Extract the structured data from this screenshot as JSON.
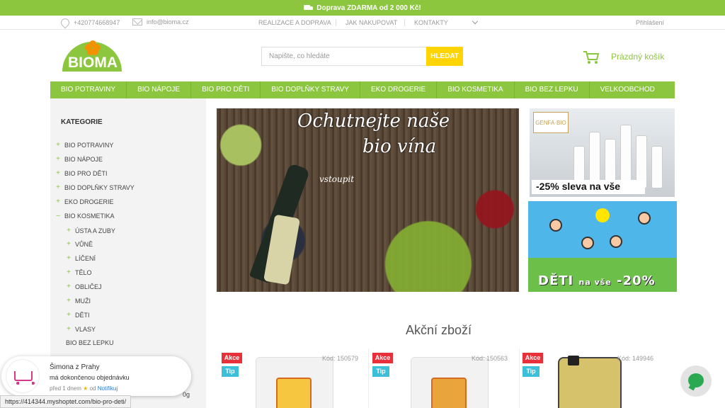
{
  "topbar": {
    "shipping_text": "Doprava ZDARMA od 2 000 Kč!"
  },
  "contact": {
    "phone": "+420774668947",
    "email": "info@bioma.cz"
  },
  "utility_nav": [
    "REALIZACE A DOPRAVA",
    "JAK NAKUPOVAT",
    "KONTAKTY"
  ],
  "login": "Přihlášení",
  "logo": {
    "text": "BIOMA"
  },
  "search": {
    "placeholder": "Napište, co hledáte",
    "button": "HLEDAT"
  },
  "cart": {
    "label": "Prázdný košík"
  },
  "main_nav": [
    "BIO POTRAVINY",
    "BIO NÁPOJE",
    "BIO PRO DĚTI",
    "BIO DOPLŇKY STRAVY",
    "EKO DROGERIE",
    "BIO KOSMETIKA",
    "BIO BEZ LEPKU",
    "VELKOOBCHOD"
  ],
  "sidebar": {
    "title": "KATEGORIE",
    "categories": [
      {
        "label": "BIO POTRAVINY",
        "sym": "+"
      },
      {
        "label": "BIO NÁPOJE",
        "sym": "+"
      },
      {
        "label": "BIO PRO DĚTI",
        "sym": "+"
      },
      {
        "label": "BIO DOPLŇKY STRAVY",
        "sym": "+"
      },
      {
        "label": "EKO DROGERIE",
        "sym": "+"
      },
      {
        "label": "BIO KOSMETIKA",
        "sym": "–"
      }
    ],
    "subcategories": [
      "ÚSTA A ZUBY",
      "VŮNĚ",
      "LÍČENÍ",
      "TĚLO",
      "OBLIČEJ",
      "MUŽI",
      "DĚTI",
      "VLASY"
    ],
    "after": "BIO BEZ LEPKU"
  },
  "hero": {
    "title_line1": "Ochutnejte naše",
    "title_line2": "bio vína",
    "cta": "vstoupit"
  },
  "promo1": {
    "brand": "GENFA·BIO",
    "label": "-25% sleva na vše"
  },
  "promo2": {
    "label_main": "DĚTI",
    "label_small": "na vše",
    "label_pct": "-20%"
  },
  "section_title": "Akční zboží",
  "products": [
    {
      "badge1": "Akce",
      "badge2": "Tip",
      "code": "Kód: 150579"
    },
    {
      "badge1": "Akce",
      "badge2": "Tip",
      "code": "Kód: 150563"
    },
    {
      "badge1": "Akce",
      "badge2": "Tip",
      "code": "Kód: 149946"
    }
  ],
  "notification": {
    "name": "Šimona z Prahy",
    "message": "má dokončenou objednávku",
    "time": "před 1 dnem",
    "from": "od",
    "link": "Notifikuj"
  },
  "status_url": "https://414344.myshoptet.com/bio-pro-deti/",
  "cut_text": "0g"
}
